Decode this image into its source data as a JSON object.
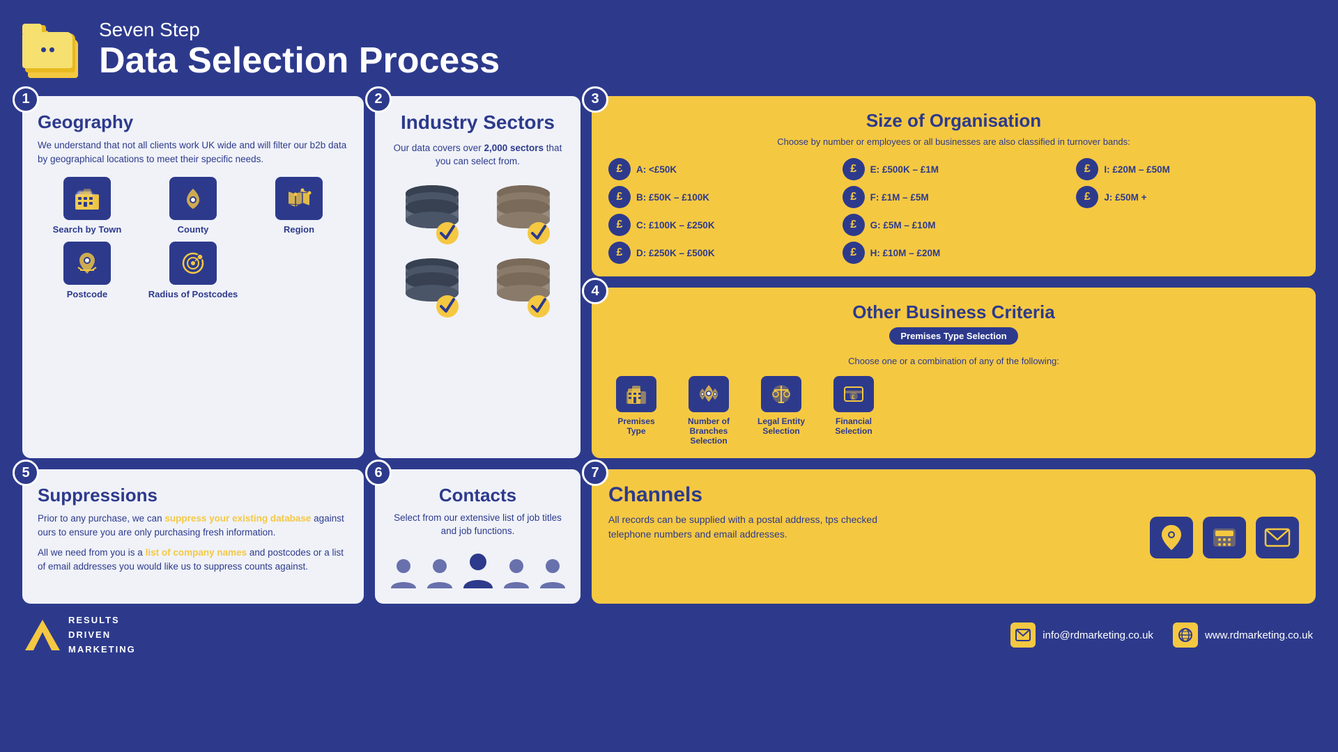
{
  "header": {
    "subtitle": "Seven Step",
    "title": "Data Selection Process",
    "logo_lines": [
      "RESULTS",
      "DRIVEN",
      "MARKETING"
    ]
  },
  "step1": {
    "badge": "1",
    "title": "Geography",
    "description": "We understand that not all clients work UK wide and will filter our b2b data by geographical locations to meet their specific needs.",
    "icons": [
      {
        "label": "Search by Town",
        "icon": "🏢"
      },
      {
        "label": "County",
        "icon": "📍"
      },
      {
        "label": "Region",
        "icon": "🗺"
      },
      {
        "label": "Postcode",
        "icon": "📮"
      },
      {
        "label": "Radius of Postcodes",
        "icon": "🎯"
      }
    ]
  },
  "step2": {
    "badge": "2",
    "title": "Industry Sectors",
    "subtitle": "Our data covers over 2,000 sectors that you can select from."
  },
  "step3": {
    "badge": "3",
    "title": "Size of Organisation",
    "subtitle": "Choose by number or employees or all businesses are also classified in turnover bands:",
    "items": [
      "A: <£50K",
      "E: £500K – £1M",
      "I: £20M – £50M",
      "B: £50K – £100K",
      "F: £1M – £5M",
      "J: £50M +",
      "C: £100K – £250K",
      "G: £5M – £10M",
      "",
      "D: £250K – £500K",
      "H: £10M – £20M",
      ""
    ]
  },
  "step4": {
    "badge": "4",
    "title": "Other Business Criteria",
    "premises_badge": "Premises Type Selection",
    "subtitle": "Choose one or a combination of any of the following:",
    "icons": [
      {
        "label": "Premises Type",
        "icon": "🏢"
      },
      {
        "label": "Number of Branches Selection",
        "icon": "📍"
      },
      {
        "label": "Legal Entity Selection",
        "icon": "⚖"
      },
      {
        "label": "Financial Selection",
        "icon": "💷"
      }
    ]
  },
  "step5": {
    "badge": "5",
    "title": "Suppressions",
    "description": "Prior to any purchase, we can",
    "highlight1": "suppress your existing database",
    "description2": " against ours to ensure you are only purchasing fresh information.",
    "description3": "All we need from you is a ",
    "highlight2": "list of company names",
    "description4": " and postcodes or a list of email addresses you would like us to suppress counts against."
  },
  "step6": {
    "badge": "6",
    "title": "Contacts",
    "subtitle": "Select from our extensive list of job titles and job functions.",
    "person_count": 5
  },
  "step7": {
    "badge": "7",
    "title": "Channels",
    "description": "All records can be supplied with a postal address, tps checked telephone numbers and email addresses.",
    "icons": [
      "📍",
      "📞",
      "✉"
    ]
  },
  "footer": {
    "email": "info@rdmarketing.co.uk",
    "website": "www.rdmarketing.co.uk"
  }
}
